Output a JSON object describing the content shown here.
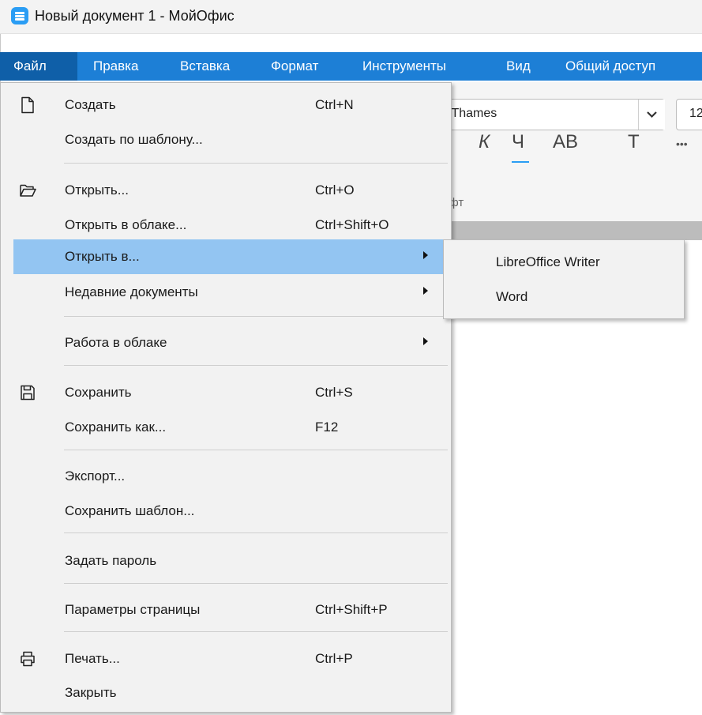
{
  "window": {
    "title": "Новый документ 1 - МойОфис",
    "app_icon": "myoffice-text-icon"
  },
  "menubar": {
    "items": [
      {
        "label": "Файл",
        "active": true
      },
      {
        "label": "Правка"
      },
      {
        "label": "Вставка"
      },
      {
        "label": "Формат"
      },
      {
        "label": "Инструменты"
      },
      {
        "label": "Вид"
      },
      {
        "label": "Общий доступ"
      }
    ]
  },
  "toolbar": {
    "font_name": "Thames",
    "font_name_prefix": ")",
    "font_size": "12",
    "italic": "К",
    "underline": "Ч",
    "caps": "АВ",
    "strike": "Т",
    "more": "•••",
    "group_label": "ифт",
    "accent_color": "#2a9df4"
  },
  "file_menu": {
    "items": [
      {
        "label": "Создать",
        "shortcut": "Ctrl+N",
        "icon": "new-document-icon"
      },
      {
        "label": "Создать по шаблону..."
      },
      {
        "label": "Открыть...",
        "shortcut": "Ctrl+O",
        "icon": "open-folder-icon"
      },
      {
        "label": "Открыть в облаке...",
        "shortcut": "Ctrl+Shift+O"
      },
      {
        "label": "Открыть в...",
        "submenu": true,
        "highlighted": true
      },
      {
        "label": "Недавние документы",
        "submenu": true
      },
      {
        "label": "Работа в облаке",
        "submenu": true
      },
      {
        "label": "Сохранить",
        "shortcut": "Ctrl+S",
        "icon": "save-icon"
      },
      {
        "label": "Сохранить как...",
        "shortcut": "F12"
      },
      {
        "label": "Экспорт..."
      },
      {
        "label": "Сохранить шаблон..."
      },
      {
        "label": "Задать пароль"
      },
      {
        "label": "Параметры страницы",
        "shortcut": "Ctrl+Shift+P"
      },
      {
        "label": "Печать...",
        "shortcut": "Ctrl+P",
        "icon": "print-icon"
      },
      {
        "label": "Закрыть"
      }
    ]
  },
  "open_in_submenu": {
    "items": [
      {
        "label": "LibreOffice Writer"
      },
      {
        "label": "Word"
      }
    ]
  },
  "colors": {
    "menubar": "#1d7fd6",
    "menubar_active": "#0f5fa8",
    "highlight": "#93c5f2"
  }
}
